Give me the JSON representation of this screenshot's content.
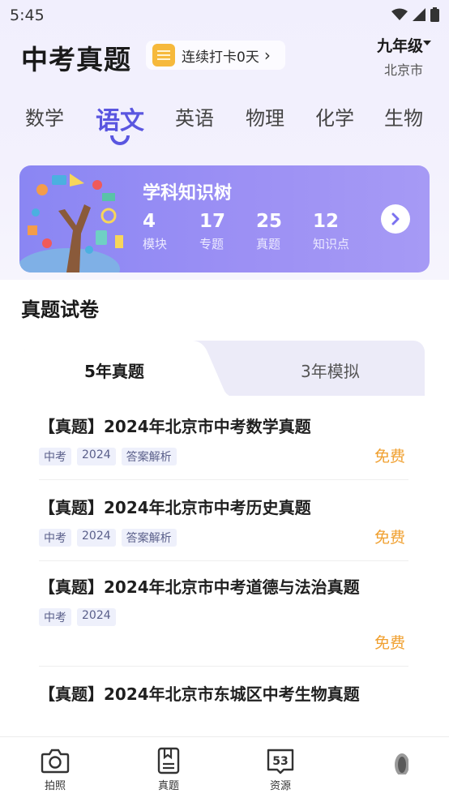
{
  "status_bar": {
    "time": "5:45"
  },
  "header": {
    "title": "中考真题",
    "checkin_label": "连续打卡0天",
    "grade": "九年级",
    "city": "北京市"
  },
  "subject_tabs": [
    {
      "label": "数学",
      "active": false
    },
    {
      "label": "语文",
      "active": true
    },
    {
      "label": "英语",
      "active": false
    },
    {
      "label": "物理",
      "active": false
    },
    {
      "label": "化学",
      "active": false
    },
    {
      "label": "生物",
      "active": false
    }
  ],
  "knowledge_tree": {
    "title": "学科知识树",
    "stats": [
      {
        "value": "4",
        "label": "模块"
      },
      {
        "value": "17",
        "label": "专题"
      },
      {
        "value": "25",
        "label": "真题"
      },
      {
        "value": "12",
        "label": "知识点"
      }
    ]
  },
  "papers_section": {
    "title": "真题试卷",
    "tabs": [
      {
        "label": "5年真题",
        "active": true
      },
      {
        "label": "3年模拟",
        "active": false
      }
    ],
    "items": [
      {
        "title": "【真题】2024年北京市中考数学真题",
        "tags": [
          "中考",
          "2024",
          "答案解析"
        ],
        "price": "免费"
      },
      {
        "title": "【真题】2024年北京市中考历史真题",
        "tags": [
          "中考",
          "2024",
          "答案解析"
        ],
        "price": "免费"
      },
      {
        "title": "【真题】2024年北京市中考道德与法治真题",
        "tags": [
          "中考",
          "2024"
        ],
        "price": "免费"
      },
      {
        "title": "【真题】2024年北京市东城区中考生物真题",
        "tags": [],
        "price": ""
      }
    ]
  },
  "bottom_nav": [
    {
      "label": "拍照",
      "icon": "camera-icon"
    },
    {
      "label": "真题",
      "icon": "exam-book-icon"
    },
    {
      "label": "资源",
      "icon": "resource-53-icon",
      "icon_text": "53"
    },
    {
      "label": "",
      "icon": "profile-icon"
    }
  ],
  "colors": {
    "accent": "#5a56e0",
    "card": "#9a92f4",
    "price": "#f0a030"
  }
}
